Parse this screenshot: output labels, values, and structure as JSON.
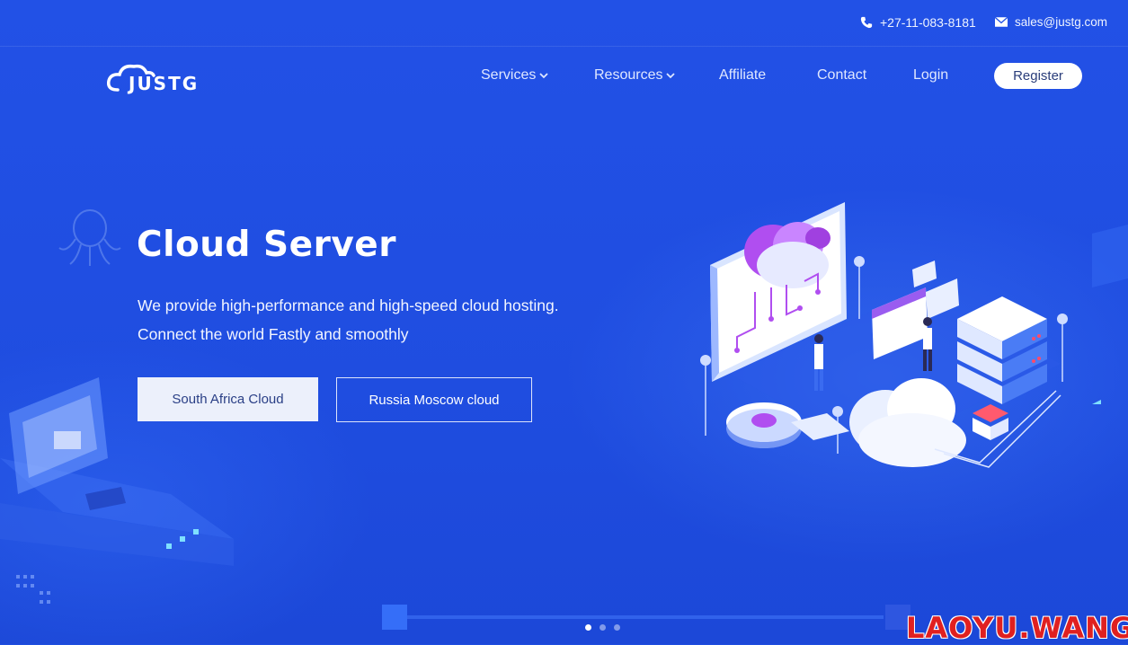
{
  "topbar": {
    "phone": "+27-11-083-8181",
    "phone_icon": "phone-icon",
    "email": "sales@justg.com",
    "email_icon": "envelope-icon"
  },
  "nav": {
    "logo_text": "JUSTG",
    "items": [
      {
        "label": "Services",
        "has_dropdown": true
      },
      {
        "label": "Resources",
        "has_dropdown": true
      },
      {
        "label": "Affiliate",
        "has_dropdown": false
      },
      {
        "label": "Contact",
        "has_dropdown": false
      },
      {
        "label": "Login",
        "has_dropdown": false
      }
    ],
    "register_label": "Register"
  },
  "hero": {
    "title": "Cloud Server",
    "line1": "We provide high-performance and high-speed cloud hosting.",
    "line2": "Connect the world Fastly and smoothly",
    "primary_button": "South Africa Cloud",
    "secondary_button": "Russia Moscow cloud"
  },
  "slider": {
    "slide_count": 3,
    "active_index": 0
  },
  "watermark": "LAOYU.WANG",
  "colors": {
    "background": "#1f4fe0",
    "button_light": "#ecf0fb",
    "watermark": "#e02020"
  }
}
